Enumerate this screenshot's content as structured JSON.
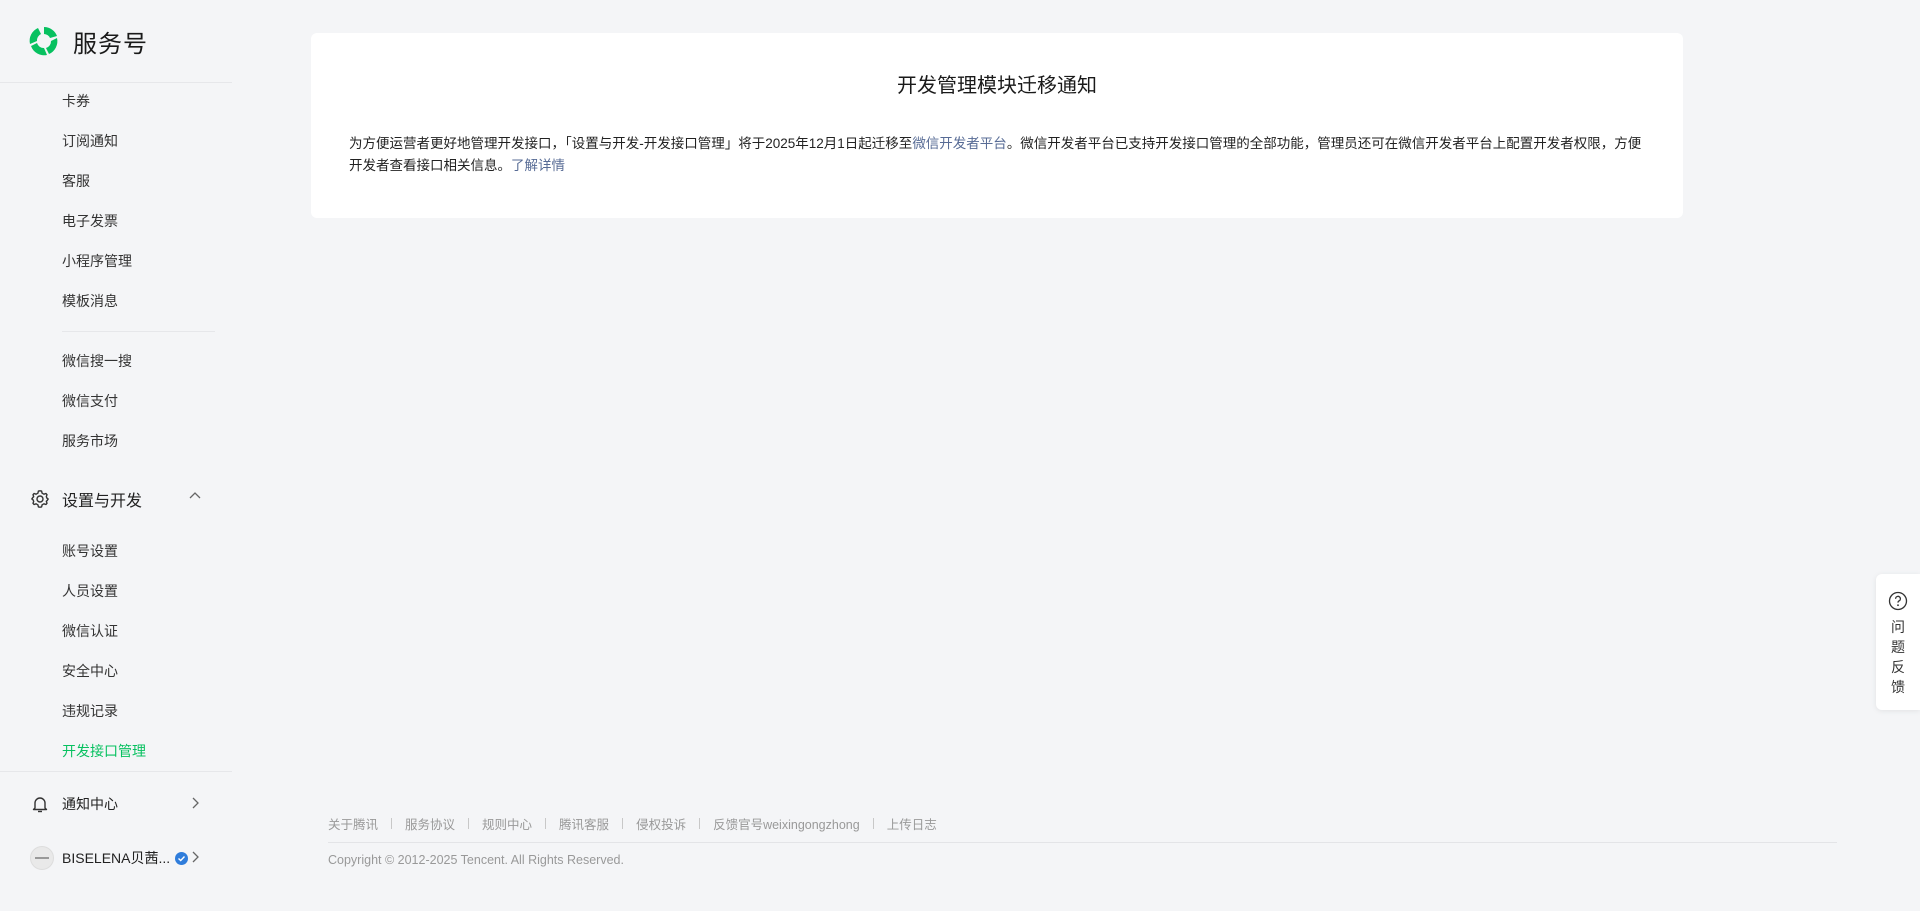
{
  "brand": {
    "name": "服务号"
  },
  "sidebar": {
    "items_top": [
      {
        "label": "卡券"
      },
      {
        "label": "订阅通知"
      },
      {
        "label": "客服"
      },
      {
        "label": "电子发票"
      },
      {
        "label": "小程序管理"
      },
      {
        "label": "模板消息"
      }
    ],
    "items_mid": [
      {
        "label": "微信搜一搜"
      },
      {
        "label": "微信支付"
      },
      {
        "label": "服务市场"
      }
    ],
    "settings_section": {
      "label": "设置与开发",
      "expanded": true,
      "icon": "gear-icon",
      "items": [
        {
          "label": "账号设置"
        },
        {
          "label": "人员设置"
        },
        {
          "label": "微信认证"
        },
        {
          "label": "安全中心"
        },
        {
          "label": "违规记录"
        },
        {
          "label": "开发接口管理",
          "active": true
        }
      ]
    },
    "notification": {
      "label": "通知中心",
      "icon": "bell-icon"
    },
    "account": {
      "name": "BISELENA贝茜...",
      "verified": true
    }
  },
  "notice": {
    "title": "开发管理模块迁移通知",
    "text_before_link": "为方便运营者更好地管理开发接口，「设置与开发-开发接口管理」将于2025年12月1日起迁移至",
    "link_platform": "微信开发者平台",
    "text_after_link": "。微信开发者平台已支持开发接口管理的全部功能，管理员还可在微信开发者平台上配置开发者权限，方便开发者查看接口相关信息。",
    "link_details": "了解详情"
  },
  "footer": {
    "links": [
      "关于腾讯",
      "服务协议",
      "规则中心",
      "腾讯客服",
      "侵权投诉",
      "反馈官号weixingongzhong",
      "上传日志"
    ],
    "copyright": "Copyright © 2012-2025 Tencent. All Rights Reserved."
  },
  "feedback": {
    "label": "问题反馈",
    "icon": "question-circle-icon"
  },
  "colors": {
    "accent": "#07c160",
    "link": "#576b95",
    "verified": "#2f7ddb"
  }
}
